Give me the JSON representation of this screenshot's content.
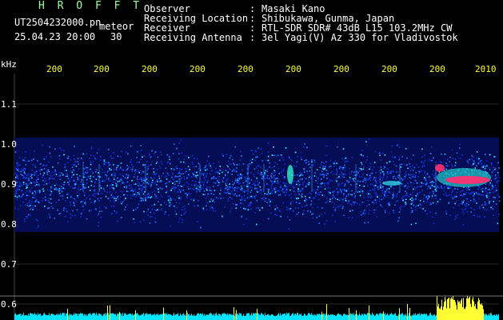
{
  "header": {
    "title": "H R O F F T",
    "filename": "UT2504232000.pn",
    "mode": "meteor",
    "datetime": "25.04.23 20:00",
    "interval": "30",
    "info": [
      {
        "key": "Observer",
        "sep": ":",
        "value": "Masaki Kano"
      },
      {
        "key": "Receiving Location",
        "sep": ":",
        "value": "Shibukawa, Gunma, Japan"
      },
      {
        "key": "Receiver",
        "sep": ":",
        "value": "RTL-SDR SDR# 43dB L15 103.2MHz CW"
      },
      {
        "key": "Receiving Antenna",
        "sep": ":",
        "value": "3el Yagi(V) Az 330 for Vladivostok"
      }
    ]
  },
  "axis": {
    "unit": "kHz",
    "y_labels": [
      "1.1",
      "1.0",
      "0.9",
      "0.8",
      "0.7",
      "0.6"
    ],
    "x_labels": [
      "200",
      "200",
      "200",
      "200",
      "200",
      "200",
      "200",
      "200",
      "200",
      "2010"
    ]
  },
  "colors": {
    "background": "#000000",
    "band": "#0a1a8c",
    "echo": "#ff3070",
    "level_cyan": "#00e5ff",
    "level_yellow": "#ffff33"
  }
}
